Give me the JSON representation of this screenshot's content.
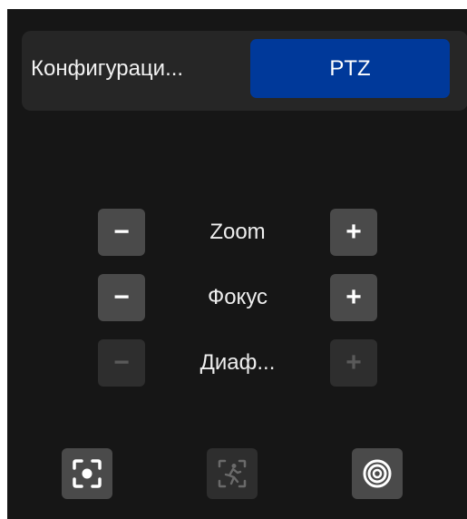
{
  "tabs": [
    {
      "label": "Конфигураци...",
      "active": false
    },
    {
      "label": "PTZ",
      "active": true
    }
  ],
  "controls": [
    {
      "label": "Zoom",
      "minus": "−",
      "plus": "+",
      "enabled": true
    },
    {
      "label": "Фокус",
      "minus": "−",
      "plus": "+",
      "enabled": true
    },
    {
      "label": "Диаф...",
      "minus": "−",
      "plus": "+",
      "enabled": false
    }
  ],
  "bottom_buttons": [
    {
      "icon": "focus-frame-icon",
      "enabled": true
    },
    {
      "icon": "person-tracking-icon",
      "enabled": false
    },
    {
      "icon": "target-rings-icon",
      "enabled": true
    }
  ],
  "colors": {
    "background": "#161616",
    "tabbar": "#262626",
    "active_tab": "#00399a",
    "button": "#4a4a4a",
    "button_disabled": "#2e2e2e"
  }
}
